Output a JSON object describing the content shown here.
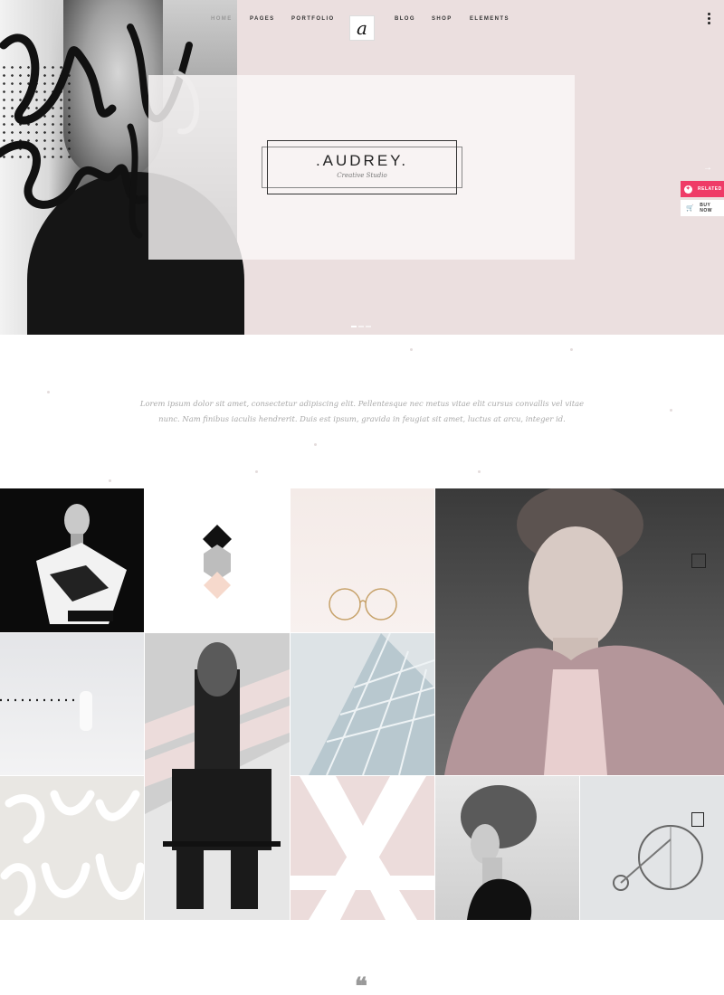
{
  "nav": {
    "left": [
      "HOME",
      "PAGES",
      "PORTFOLIO"
    ],
    "right": [
      "BLOG",
      "SHOP",
      "ELEMENTS"
    ],
    "logo_glyph": "a"
  },
  "hero": {
    "title": ".AUDREY.",
    "subtitle": "Creative Studio",
    "arrow": "→"
  },
  "side_buttons": {
    "related": "RELATED",
    "buy": "BUY NOW"
  },
  "intro": {
    "text": "Lorem ipsum dolor sit amet, consectetur adipiscing elit. Pellentesque nec metus vitae elit cursus convallis vel vitae nunc. Nam finibus iaculis hendrerit. Duis est ipsum, gravida in feugiat sit amet, luctus at arcu, integer id."
  },
  "quote_mark": "❝",
  "colors": {
    "hero_bg": "#ebdfdf",
    "accent": "#ef3b67",
    "intro_text": "#a9a9a9"
  }
}
